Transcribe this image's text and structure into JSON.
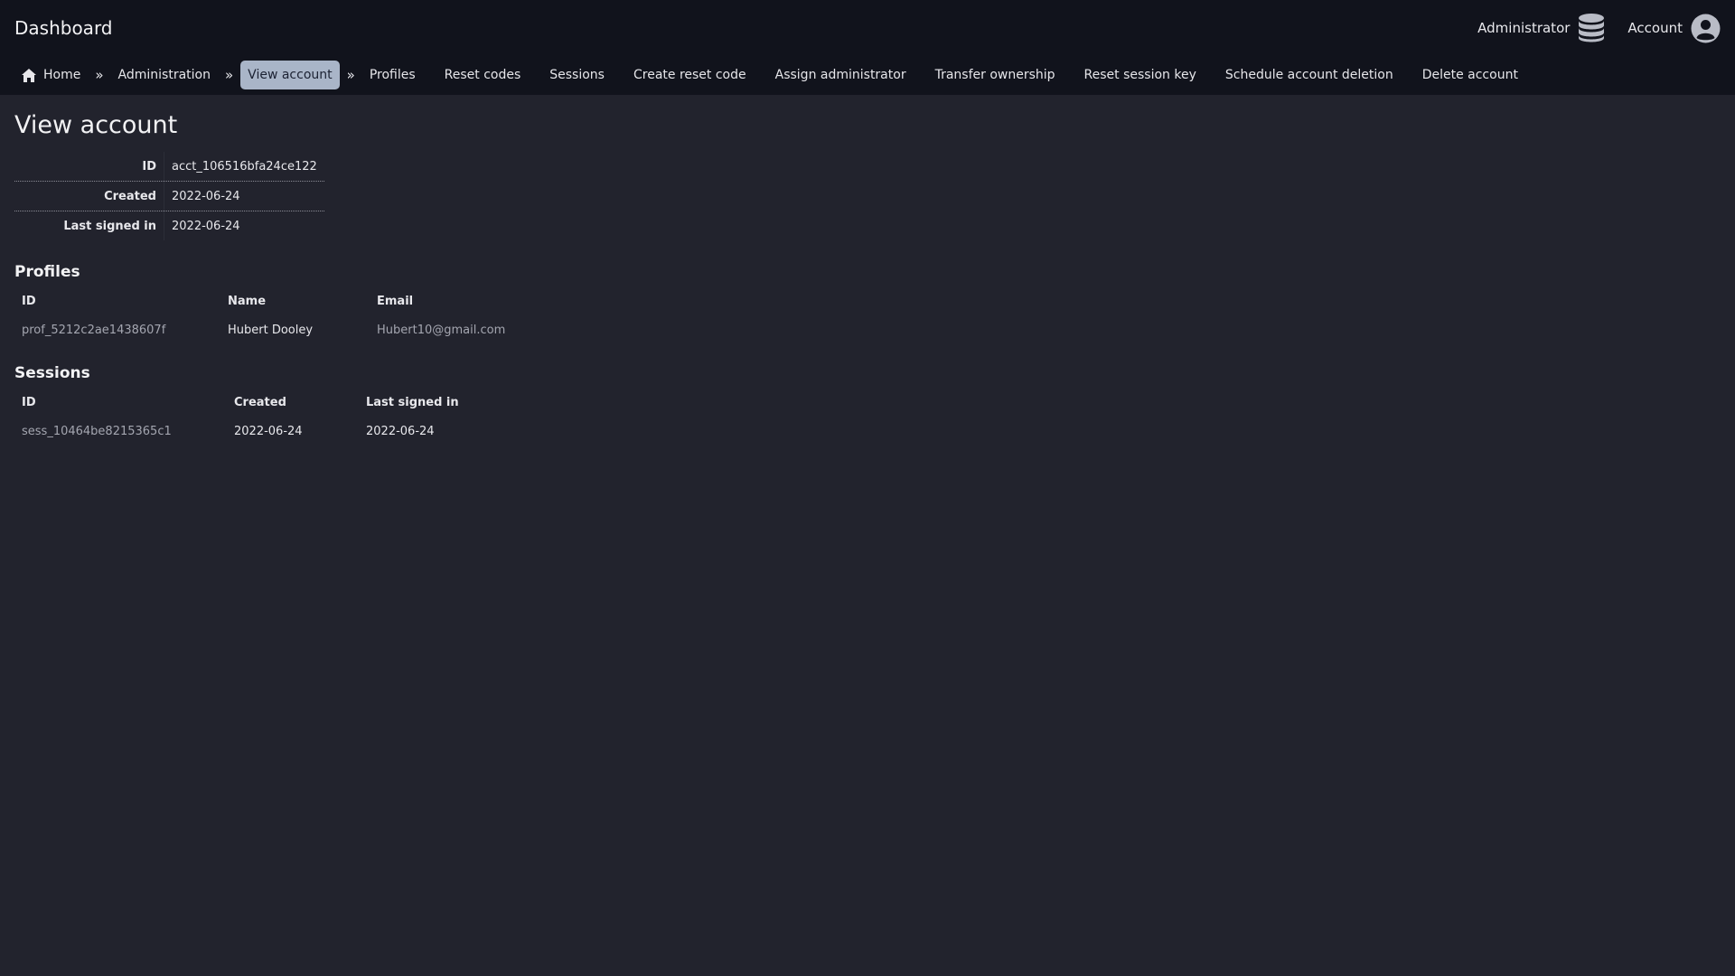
{
  "header": {
    "title": "Dashboard",
    "admin_label": "Administrator",
    "account_label": "Account"
  },
  "breadcrumb": {
    "home": "Home",
    "administration": "Administration",
    "current": "View account",
    "separator": "»",
    "actions": [
      "Profiles",
      "Reset codes",
      "Sessions",
      "Create reset code",
      "Assign administrator",
      "Transfer ownership",
      "Reset session key",
      "Schedule account deletion",
      "Delete account"
    ]
  },
  "page": {
    "title": "View account"
  },
  "account": {
    "id_label": "ID",
    "id": "acct_106516bfa24ce122",
    "created_label": "Created",
    "created": "2022-06-24",
    "last_signed_in_label": "Last signed in",
    "last_signed_in": "2022-06-24"
  },
  "profiles": {
    "title": "Profiles",
    "columns": [
      "ID",
      "Name",
      "Email"
    ],
    "rows": [
      {
        "id": "prof_5212c2ae1438607f",
        "name": "Hubert Dooley",
        "email": "Hubert10@gmail.com"
      }
    ]
  },
  "sessions": {
    "title": "Sessions",
    "columns": [
      "ID",
      "Created",
      "Last signed in"
    ],
    "rows": [
      {
        "id": "sess_10464be8215365c1",
        "created": "2022-06-24",
        "last_signed_in": "2022-06-24"
      }
    ]
  },
  "colors": {
    "background": "#22232d",
    "topbar": "#11131c",
    "active_crumb": "#a9b5c8"
  }
}
